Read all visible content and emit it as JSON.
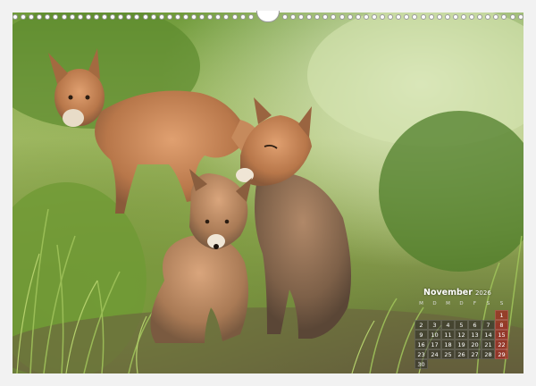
{
  "calendar": {
    "month": "November",
    "year": "2026",
    "weekdays": [
      "M",
      "D",
      "M",
      "D",
      "F",
      "S",
      "S"
    ],
    "weeks": [
      [
        "",
        "",
        "",
        "",
        "",
        "",
        "1"
      ],
      [
        "2",
        "3",
        "4",
        "5",
        "6",
        "7",
        "8"
      ],
      [
        "9",
        "10",
        "11",
        "12",
        "13",
        "14",
        "15"
      ],
      [
        "16",
        "17",
        "18",
        "19",
        "20",
        "21",
        "22"
      ],
      [
        "23",
        "24",
        "25",
        "26",
        "27",
        "28",
        "29"
      ],
      [
        "30",
        "",
        "",
        "",
        "",
        "",
        ""
      ]
    ]
  },
  "photo": {
    "subject": "fox-cubs-photo"
  }
}
